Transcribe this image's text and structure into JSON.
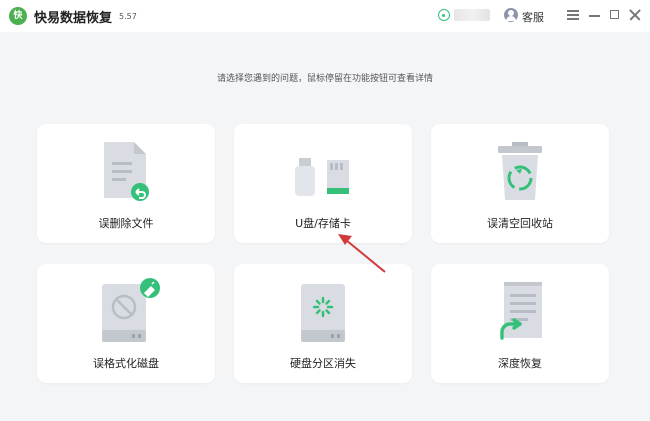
{
  "titlebar": {
    "app_title": "快易数据恢复",
    "version": "5.57",
    "logo_text": "快",
    "service_label": "客服"
  },
  "hint": "请选择您遇到的问题，鼠标停留在功能按钮可查看详情",
  "cards": [
    {
      "label": "误删除文件",
      "icon": "document-restore-icon"
    },
    {
      "label": "U盘/存储卡",
      "icon": "usb-sdcard-icon"
    },
    {
      "label": "误清空回收站",
      "icon": "recycle-bin-icon"
    },
    {
      "label": "误格式化磁盘",
      "icon": "formatted-disk-icon"
    },
    {
      "label": "硬盘分区消失",
      "icon": "partition-loading-icon"
    },
    {
      "label": "深度恢复",
      "icon": "deep-restore-icon"
    }
  ],
  "colors": {
    "accent_green": "#35c07a",
    "icon_gray": "#d9dde3",
    "annotation_red": "#d23b3b"
  }
}
